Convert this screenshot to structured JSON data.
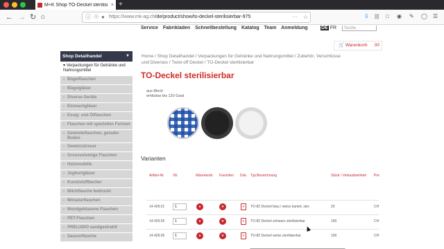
{
  "browser": {
    "tab_title": "M+K Shop TO-Deckel sterilisi",
    "tab_close": "×",
    "new_tab": "+",
    "url_host": "https://www.mk-ag.ch",
    "url_path": "/de/product/show/to-deckel-sterilisierbar-975",
    "url_more": "···"
  },
  "topnav": {
    "items": [
      "Service",
      "Fabrikladen",
      "Schnellbestellung",
      "Katalog",
      "Team",
      "Anmeldung"
    ],
    "lang_de": "DE",
    "lang_fr": "FR",
    "search_placeholder": "Suche"
  },
  "cart": {
    "label": "Warenkorb",
    "count": "00"
  },
  "sidebar": {
    "header": "Shop Detailhandel",
    "active": "Verpackungen für Getränke und Nahrungsmittel",
    "items": [
      "Bügelflaschen",
      "Bügelgläser",
      "Diverse Geräte",
      "Einmachgläser",
      "Essig- und Ölflaschen",
      "Flaschen mit speziellen Formen",
      "Gewindeflaschen, gerader Boden",
      "Gewürzstreuer",
      "Grossvolumige Flaschen",
      "Holzmodelle",
      "Joghurtgläser",
      "Kunststoffbecher",
      "Milchflasche bedruckt",
      "Miniaturflaschen",
      "Mundgeblasene Flaschen",
      "PET-Flaschen",
      "PRELUDIO sandgestrahlt",
      "Saucenflasche"
    ]
  },
  "breadcrumb": "Home / Shop Detailhandel / Verpackungen für Getränke und Nahrungsmittel / Zubehör, Verschlüsse und Diverses / Twist-off Deckel / TO-Deckel sterilisierbar",
  "product": {
    "title": "TO-Deckel sterilisierbar",
    "desc_1": "aus Blech",
    "desc_2": "erhitzbar bis 120 Grad"
  },
  "variants": {
    "heading": "Varianten",
    "headers": [
      "Artikel-Nr.",
      "VE",
      "Warenkorb",
      "Favoriten",
      "Dok.",
      "Typ",
      "Bezeichnung",
      "Stück / Verkaufseinheit",
      "Pre"
    ],
    "rows": [
      {
        "art": "14.429.01",
        "qty": "1",
        "desc": "TO-82 Deckel blau / weiss kariert, ster.",
        "units": "20",
        "price": "CH"
      },
      {
        "art": "14.429.05",
        "qty": "1",
        "desc": "TO-82 Deckel schwarz sterilisierbar",
        "units": "100",
        "price": "CH"
      },
      {
        "art": "14.429.06",
        "qty": "1",
        "desc": "TO-82 Deckel weiss sterilisierbar",
        "units": "100",
        "price": "CH"
      }
    ]
  },
  "colors": {
    "accent": "#c8272e",
    "sidebar_header": "#35384a",
    "sidebar_item": "#d6d6d6"
  }
}
